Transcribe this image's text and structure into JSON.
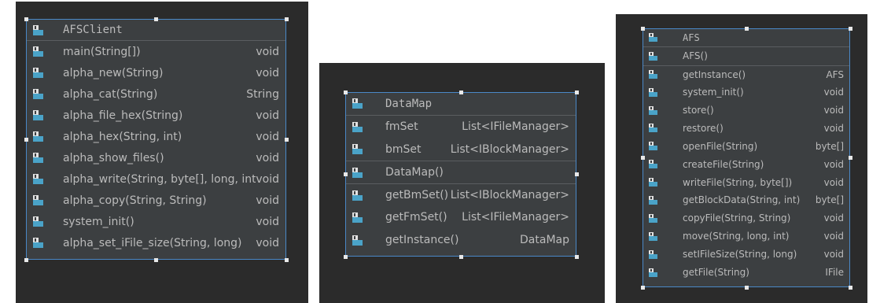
{
  "diagrams": [
    {
      "id": "afsclient",
      "title": "AFSClient",
      "sections": [
        [
          {
            "name": "main(String[])",
            "type": "void"
          },
          {
            "name": "alpha_new(String)",
            "type": "void"
          },
          {
            "name": "alpha_cat(String)",
            "type": "String"
          },
          {
            "name": "alpha_file_hex(String)",
            "type": "void"
          },
          {
            "name": "alpha_hex(String, int)",
            "type": "void"
          },
          {
            "name": "alpha_show_files()",
            "type": "void"
          },
          {
            "name": "alpha_write(String, byte[], long, int)",
            "type": "void"
          },
          {
            "name": "alpha_copy(String, String)",
            "type": "void"
          },
          {
            "name": "system_init()",
            "type": "void"
          },
          {
            "name": "alpha_set_iFile_size(String, long)",
            "type": "void"
          }
        ]
      ]
    },
    {
      "id": "datamap",
      "title": "DataMap",
      "sections": [
        [
          {
            "name": "fmSet",
            "type": "List<IFileManager>"
          },
          {
            "name": "bmSet",
            "type": "List<IBlockManager>"
          }
        ],
        [
          {
            "name": "DataMap()",
            "type": ""
          }
        ],
        [
          {
            "name": "getBmSet()",
            "type": "List<IBlockManager>"
          },
          {
            "name": "getFmSet()",
            "type": "List<IFileManager>"
          },
          {
            "name": "getInstance()",
            "type": "DataMap"
          }
        ]
      ]
    },
    {
      "id": "afs",
      "title": "AFS",
      "sections": [
        [
          {
            "name": "AFS()",
            "type": ""
          }
        ],
        [
          {
            "name": "getInstance()",
            "type": "AFS"
          },
          {
            "name": "system_init()",
            "type": "void"
          },
          {
            "name": "store()",
            "type": "void"
          },
          {
            "name": "restore()",
            "type": "void"
          },
          {
            "name": "openFile(String)",
            "type": "byte[]"
          },
          {
            "name": "createFile(String)",
            "type": "void"
          },
          {
            "name": "writeFile(String, byte[])",
            "type": "void"
          },
          {
            "name": "getBlockData(String, int)",
            "type": "byte[]"
          },
          {
            "name": "copyFile(String, String)",
            "type": "void"
          },
          {
            "name": "move(String, long, int)",
            "type": "void"
          },
          {
            "name": "setIFileSize(String, long)",
            "type": "void"
          },
          {
            "name": "getFile(String)",
            "type": "IFile"
          }
        ]
      ]
    }
  ],
  "icon_name": "java-class-member-icon",
  "colors": {
    "panel": "#2b2b2b",
    "box": "#3c3f41",
    "border": "#4a88c7",
    "text": "#bbbbbb",
    "icon": "#4aa3c8"
  }
}
